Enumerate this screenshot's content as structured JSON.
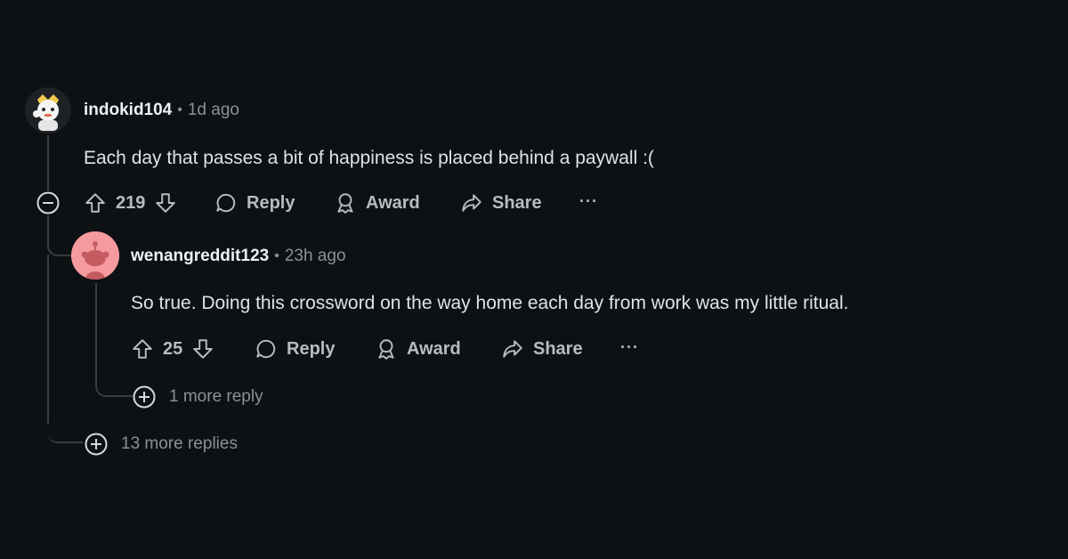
{
  "comment1": {
    "username": "indokid104",
    "time": "1d ago",
    "text": "Each day that passes a bit of happiness is placed behind a paywall :(",
    "votes": "219",
    "reply_label": "Reply",
    "award_label": "Award",
    "share_label": "Share",
    "more_label": "···",
    "more_replies_label": "13 more replies"
  },
  "comment2": {
    "username": "wenangreddit123",
    "time": "23h ago",
    "text": "So true. Doing this crossword on the way home each day from work was my little ritual.",
    "votes": "25",
    "reply_label": "Reply",
    "award_label": "Award",
    "share_label": "Share",
    "more_label": "···",
    "more_replies_label": "1 more reply"
  },
  "separator": "•",
  "colors": {
    "background": "#0e1113",
    "text": "#dfe3e6",
    "muted": "#8a9195",
    "thread_line": "#3a3d40",
    "avatar2_bg": "#f59a9e"
  },
  "icons": [
    "collapse-icon",
    "upvote-icon",
    "downvote-icon",
    "reply-icon",
    "award-icon",
    "share-icon",
    "expand-icon"
  ]
}
